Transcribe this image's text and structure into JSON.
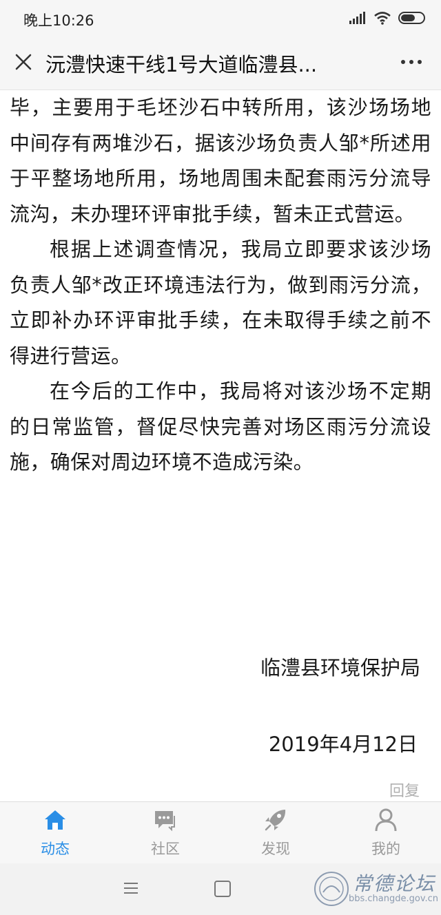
{
  "status_bar": {
    "time": "晚上10:26"
  },
  "title_bar": {
    "title": "沅澧快速干线1号大道临澧县..."
  },
  "article": {
    "paragraphs": [
      {
        "text": "毕，主要用于毛坯沙石中转所用，该沙场场地中间存有两堆沙石，据该沙场负责人邹*所述用于平整场地所用，场地周围未配套雨污分流导流沟，未办理环评审批手续，暂未正式营运。",
        "indent": false
      },
      {
        "text": "根据上述调查情况，我局立即要求该沙场负责人邹*改正环境违法行为，做到雨污分流，立即补办环评审批手续，在未取得手续之前不得进行营运。",
        "indent": true
      },
      {
        "text": "在今后的工作中，我局将对该沙场不定期的日常监管，督促尽快完善对场区雨污分流设施，确保对周边环境不造成污染。",
        "indent": true
      }
    ],
    "signature": "临澧县环境保护局",
    "date": "2019年4月12日"
  },
  "reply_label": "回复",
  "tabs": [
    {
      "label": "动态",
      "icon": "home-icon",
      "active": true
    },
    {
      "label": "社区",
      "icon": "chat-bubble-icon",
      "active": false
    },
    {
      "label": "发现",
      "icon": "rocket-icon",
      "active": false
    },
    {
      "label": "我的",
      "icon": "user-icon",
      "active": false
    }
  ],
  "watermark": {
    "text": "常德论坛",
    "url": "bbs.changde.gov.cn"
  },
  "colors": {
    "accent": "#2a8ee6",
    "inactive": "#999999"
  }
}
